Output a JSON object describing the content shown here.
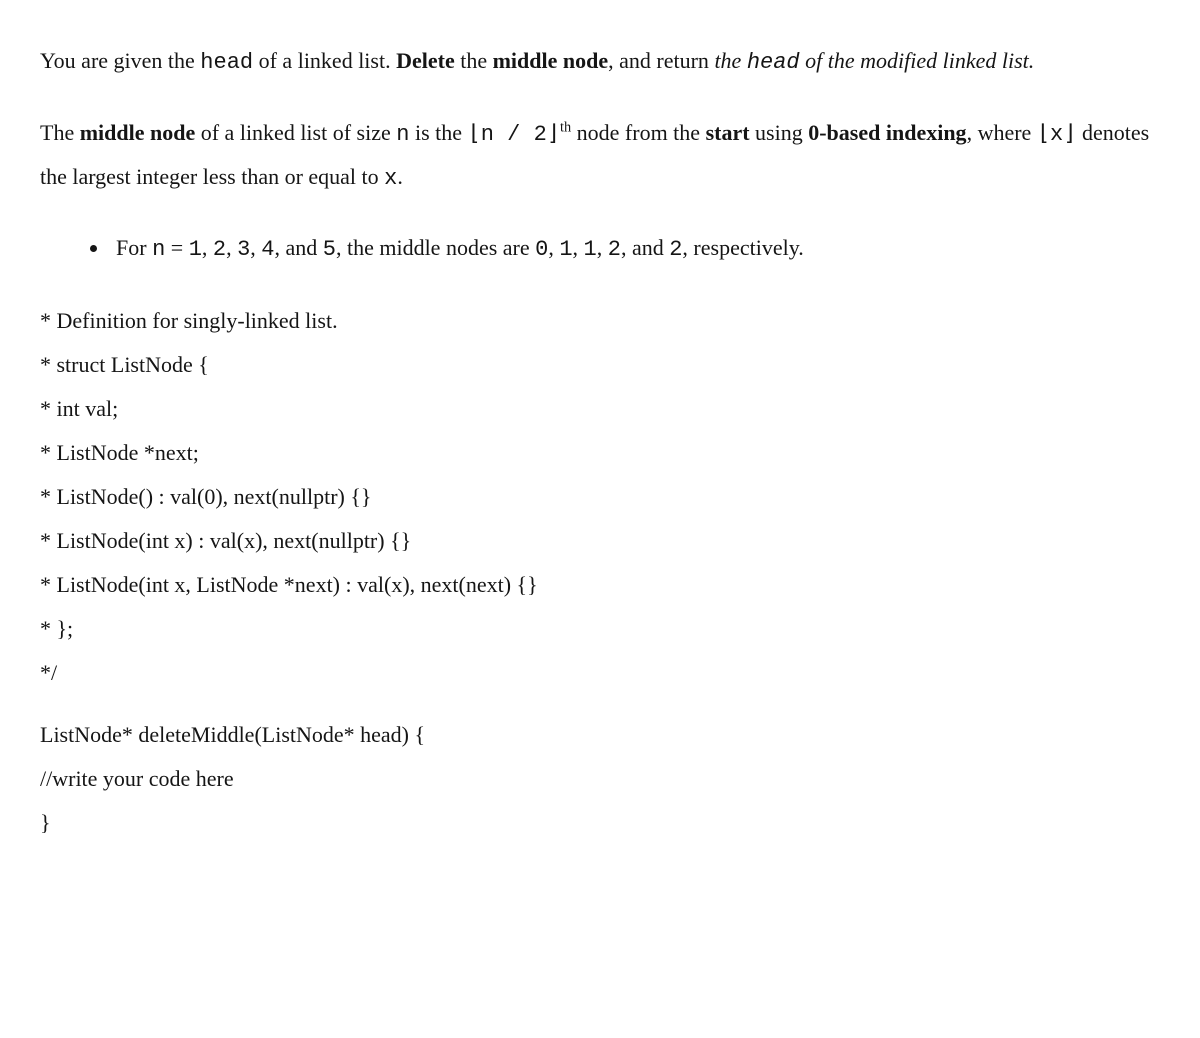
{
  "para1": {
    "t1": "You are given the ",
    "head": "head",
    "t2": " of a linked list. ",
    "delete": "Delete",
    "t3": " the ",
    "middle_node": "middle node",
    "t4": ", and return ",
    "the": "the ",
    "head2": "head",
    "t5": " of the modified linked list."
  },
  "para2": {
    "t1": "The ",
    "middle_node": "middle node",
    "t2": " of a linked list of size ",
    "n": "n",
    "t3": " is the ",
    "expr": "⌊n / 2⌋",
    "sup": "th",
    "t4": " node from the ",
    "start": "start",
    "t5": " using ",
    "zero": "0-based indexing",
    "t6": ", where ",
    "floor": "⌊x⌋",
    "t7": " denotes the largest integer less than or equal to ",
    "x": "x",
    "t8": "."
  },
  "bullet": {
    "t1": "For ",
    "n": "n",
    "t2": " = ",
    "list1": "1",
    "c1": ", ",
    "list2": "2",
    "c2": ", ",
    "list3": "3",
    "c3": ", ",
    "list4": "4",
    "c4": ", and ",
    "list5": "5",
    "t3": ", the middle nodes are ",
    "m1": "0",
    "mc1": ", ",
    "m2": "1",
    "mc2": ", ",
    "m3": "1",
    "mc3": ", ",
    "m4": "2",
    "mc4": ", and ",
    "m5": "2",
    "t4": ", respectively."
  },
  "code": {
    "l1": "* Definition for singly-linked list.",
    "l2": "* struct ListNode {",
    "l3": "* int val;",
    "l4": "* ListNode *next;",
    "l5": "* ListNode() : val(0), next(nullptr) {}",
    "l6": "* ListNode(int x) : val(x), next(nullptr) {}",
    "l7": "* ListNode(int x, ListNode *next) : val(x), next(next) {}",
    "l8": "* };",
    "l9": "*/",
    "l10": "ListNode* deleteMiddle(ListNode* head) {",
    "l11": "//write your code here",
    "l12": "}"
  }
}
